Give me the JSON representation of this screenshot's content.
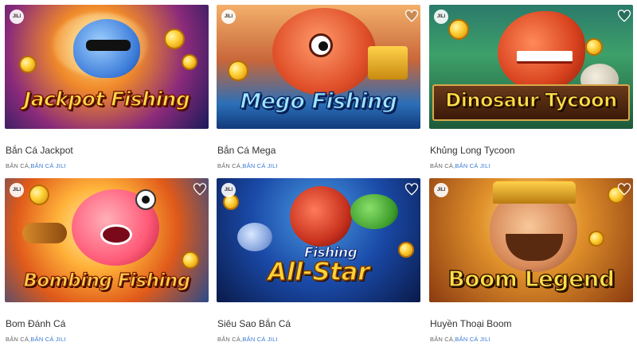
{
  "cards": [
    {
      "title": "Bắn Cá Jackpot",
      "logo": "Jackpot Fishing",
      "badge": "JILI",
      "category_1": "BẮN CÁ",
      "separator": ",",
      "category_2": "BẮN CÁ JILI"
    },
    {
      "title": "Bắn Cá Mega",
      "logo": "Mego Fishing",
      "badge": "JILI",
      "category_1": "BẮN CÁ",
      "separator": ",",
      "category_2": "BẮN CÁ JILI"
    },
    {
      "title": "Khủng Long Tycoon",
      "logo": "Dinosaur Tycoon",
      "badge": "JILI",
      "category_1": "BẮN CÁ",
      "separator": ",",
      "category_2": "BẮN CÁ JILI"
    },
    {
      "title": "Bom Đánh Cá",
      "logo": "Bombing Fishing",
      "badge": "JILI",
      "category_1": "BẮN CÁ",
      "separator": ",",
      "category_2": "BẮN CÁ JILI"
    },
    {
      "title": "Siêu Sao Bắn Cá",
      "logo_top": "Fishing",
      "logo": "All-Star",
      "badge": "JILI",
      "category_1": "BẮN CÁ",
      "separator": ",",
      "category_2": "BẮN CÁ JILI"
    },
    {
      "title": "Huyền Thoại Boom",
      "logo": "Boom Legend",
      "badge": "JILI",
      "category_1": "BẮN CÁ",
      "separator": ",",
      "category_2": "BẮN CÁ JILI"
    }
  ],
  "colors": {
    "link": "#3a7bd5",
    "title_text": "#333333",
    "category_text": "#666666"
  },
  "icons": {
    "favorite": "heart-outline-icon",
    "provider": "jili-badge-icon"
  }
}
